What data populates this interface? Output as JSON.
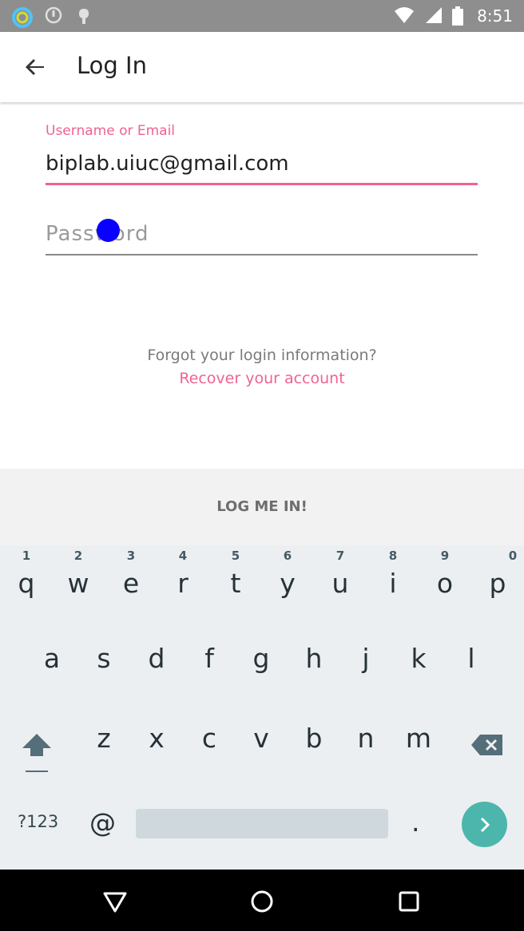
{
  "status_bar": {
    "time": "8:51",
    "icons": [
      "circle-app-icon",
      "info-circle-icon",
      "android-debug-icon",
      "wifi-icon",
      "signal-icon",
      "battery-icon"
    ]
  },
  "app_bar": {
    "title": "Log In",
    "back_icon": "arrow-back-icon"
  },
  "form": {
    "username_label": "Username or Email",
    "username_value": "biplab.uiuc@gmail.com",
    "password_placeholder": "Password",
    "accent_color": "#f06292"
  },
  "forgot": {
    "prompt": "Forgot your login information?",
    "link": "Recover your account"
  },
  "login_button": "LOG ME IN!",
  "keyboard": {
    "row1": [
      {
        "letter": "q",
        "num": "1"
      },
      {
        "letter": "w",
        "num": "2"
      },
      {
        "letter": "e",
        "num": "3"
      },
      {
        "letter": "r",
        "num": "4"
      },
      {
        "letter": "t",
        "num": "5"
      },
      {
        "letter": "y",
        "num": "6"
      },
      {
        "letter": "u",
        "num": "7"
      },
      {
        "letter": "i",
        "num": "8"
      },
      {
        "letter": "o",
        "num": "9"
      },
      {
        "letter": "p",
        "num": "0"
      }
    ],
    "row2": [
      "a",
      "s",
      "d",
      "f",
      "g",
      "h",
      "j",
      "k",
      "l"
    ],
    "row3": [
      "z",
      "x",
      "c",
      "v",
      "b",
      "n",
      "m"
    ],
    "symbols_key": "?123",
    "at_key": "@",
    "period_key": ".",
    "shift_icon": "shift-icon",
    "backspace_icon": "backspace-icon",
    "go_icon": "chevron-right-icon",
    "go_color": "#4db6ac"
  },
  "nav_bar": {
    "icons": [
      "back-triangle-icon",
      "home-circle-icon",
      "recents-square-icon"
    ]
  }
}
